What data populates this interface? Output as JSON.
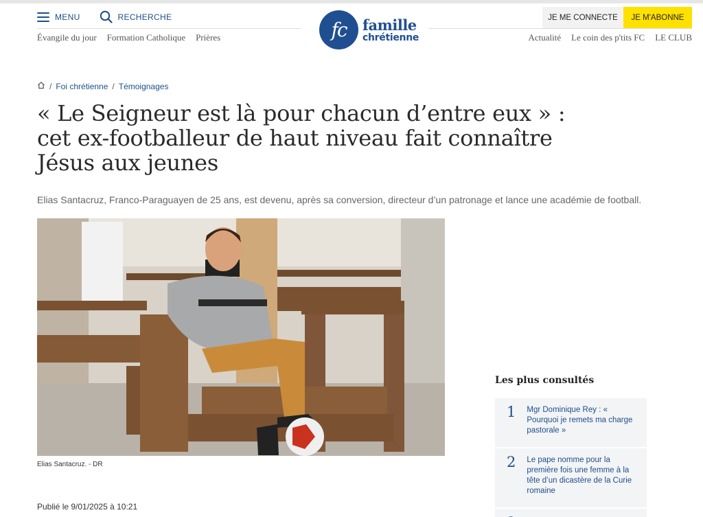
{
  "header": {
    "menu_label": "MENU",
    "search_label": "RECHERCHE",
    "logo_monogram": "fc",
    "logo_word1": "famille",
    "logo_word2": "chrétienne",
    "login_label": "JE ME CONNECTE",
    "subscribe_label": "JE M'ABONNE"
  },
  "subnav_left": [
    "Évangile du jour",
    "Formation Catholique",
    "Prières"
  ],
  "subnav_right": [
    "Actualité",
    "Le coin des p'tits FC",
    "LE CLUB"
  ],
  "breadcrumb": [
    "Foi chrétienne",
    "Témoignages"
  ],
  "article": {
    "title": "« Le Seigneur est là pour chacun d’entre eux » : cet ex-footballeur de haut niveau fait connaître Jésus aux jeunes",
    "lead": "Elias Santacruz, Franco-Paraguayen de 25 ans, est devenu, après sa conversion, directeur d’un patronage et lance une académie de football.",
    "caption": "Elias Santacruz.  - DR",
    "published": "Publié le 9/01/2025 à 10:21"
  },
  "sidebar": {
    "title": "Les plus consultés",
    "items": [
      {
        "num": "1",
        "text": "Mgr Dominique Rey : « Pourquoi je remets ma charge pastorale »"
      },
      {
        "num": "2",
        "text": "Le pape nomme pour la première fois une femme à la tête d’un dicastère de la Curie romaine"
      },
      {
        "num": "3",
        "text": ""
      }
    ]
  },
  "colors": {
    "brand_blue": "#1f4f91",
    "link_blue": "#1d4e89",
    "subscribe_yellow": "#ffe100"
  },
  "icons": [
    "hamburger-icon",
    "search-icon",
    "home-icon"
  ]
}
